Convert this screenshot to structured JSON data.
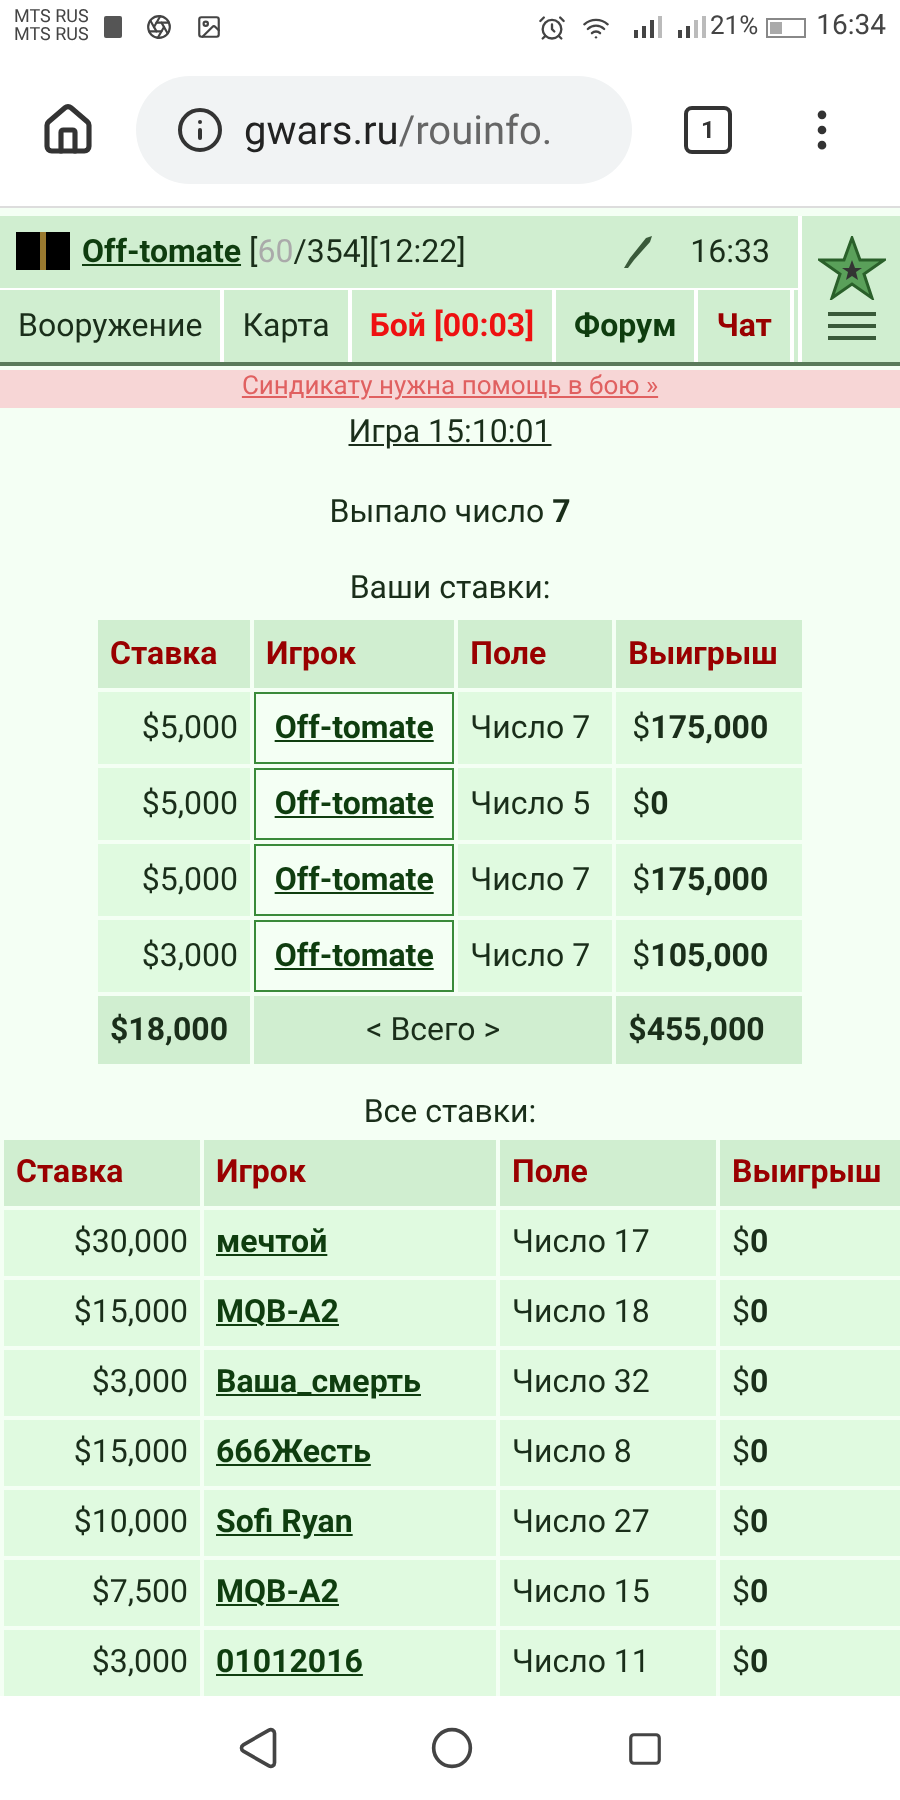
{
  "status_bar": {
    "carriers": [
      "MTS RUS",
      "MTS RUS"
    ],
    "battery": "21%",
    "time": "16:34"
  },
  "browser": {
    "url_host": "gwars.ru",
    "url_path": "/rouinfo.",
    "tab_count": "1"
  },
  "header": {
    "player": "Off-tomate",
    "hp_current": "60",
    "hp_rest": "/354][12:22]",
    "hp_open": "[",
    "time": "16:33"
  },
  "nav": [
    {
      "label": "Вооружение",
      "kind": "plain"
    },
    {
      "label": "Карта",
      "kind": "plain"
    },
    {
      "label": "Бой [00:03]",
      "kind": "alert"
    },
    {
      "label": "Форум",
      "kind": "bold"
    },
    {
      "label": "Чат",
      "kind": "chat"
    }
  ],
  "banner": "Синдикату нужна помощь в бою »",
  "game_title": "Игра 15:10:01",
  "result": "Выпало число **7**",
  "my_bets": {
    "title": "Ваши ставки:",
    "columns": [
      "Ставка",
      "Игрок",
      "Поле",
      "Выигрыш"
    ],
    "rows": [
      [
        "$5,000",
        "Off-tomate",
        "Число 7",
        "$**175,000**"
      ],
      [
        "$5,000",
        "Off-tomate",
        "Число 5",
        "$**0**"
      ],
      [
        "$5,000",
        "Off-tomate",
        "Число 7",
        "$**175,000**"
      ],
      [
        "$3,000",
        "Off-tomate",
        "Число 7",
        "$**105,000**"
      ]
    ],
    "total": {
      "stake": "$18,000",
      "label": "< Всего >",
      "win": "$455,000"
    }
  },
  "all_bets": {
    "title": "Все ставки:",
    "columns": [
      "Ставка",
      "Игрок",
      "Поле",
      "Выигрыш"
    ],
    "rows": [
      [
        "$30,000",
        "мечтой",
        "Число 17",
        "$**0**"
      ],
      [
        "$15,000",
        "MQB-A2",
        "Число 18",
        "$**0**"
      ],
      [
        "$3,000",
        "Ваша_смерть",
        "Число 32",
        "$**0**"
      ],
      [
        "$15,000",
        "666Жесть",
        "Число 8",
        "$**0**"
      ],
      [
        "$10,000",
        "Sofi Ryan",
        "Число 27",
        "$**0**"
      ],
      [
        "$7,500",
        "MQB-A2",
        "Число 15",
        "$**0**"
      ],
      [
        "$3,000",
        "01012016",
        "Число 11",
        "$**0**"
      ]
    ]
  }
}
